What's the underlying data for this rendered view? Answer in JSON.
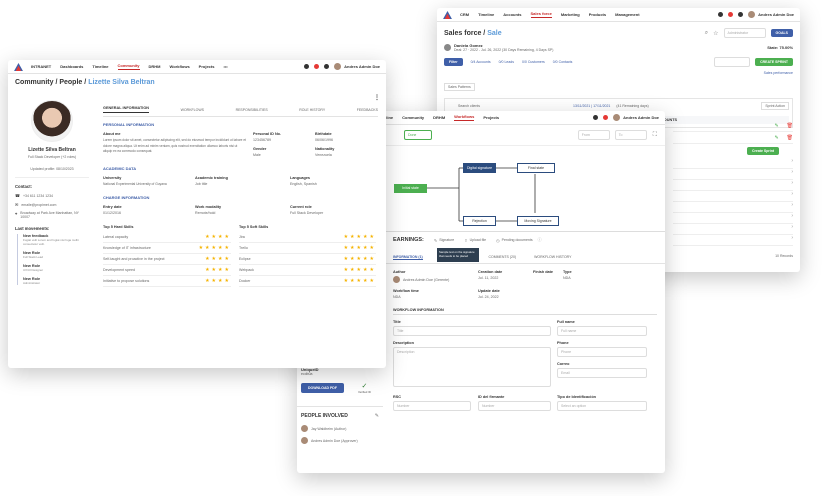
{
  "back_window": {
    "nav": [
      "CRM",
      "Timeline",
      "Accounts",
      "Sales force",
      "Marketing",
      "Products",
      "Management"
    ],
    "user": "Andres Admin Doe",
    "title_main": "Sales force / ",
    "title_accent": "Sale",
    "owner_name": "Daniela Gomez",
    "owner_meta": "Deal: 27 · 2022 - Jul. 26, 2022 (30 Days Remaining, 4 Days SP)",
    "state_label": "State: 75.00%",
    "filter_btn": "Filter",
    "tabs": [
      "0/4 Accounts",
      "0/0 Leads",
      "0/0 Customers",
      "0/0 Contacts"
    ],
    "create_btn": "CREATE SPRINT",
    "goals_btn": "GOALS",
    "admin_select": "Administrator",
    "sales_performance": "Sales performance",
    "sales_patterns": "Sales Patterns",
    "search_clients": "Search clients",
    "date_range": "13/11/2021 | 17/11/2021",
    "remaining": "(41 Remaining days)",
    "sprint_action": "Sprint Action",
    "col_title": "TITLE",
    "col_accounts": "ACCOUNTS",
    "create_sprint_small": "Create Sprint",
    "records": "10 Records"
  },
  "middle_window": {
    "nav": [
      "Timeline",
      "Community",
      "DRHM",
      "Workflows",
      "Projects"
    ],
    "user": "Andres Admin Doe",
    "done_select": "Done",
    "from_select": "From",
    "to_select": "To",
    "flow_initial": "Initial state",
    "flow_digital": "Digital signature",
    "flow_final": "Final state",
    "flow_rejection": "Rejection",
    "flow_moving": "Moving Signature",
    "tooltip": "Sample text on the signature that needs to be placed",
    "earnings_title": "EARNINGS:",
    "action_signature": "Signature",
    "action_upload": "Upload file",
    "action_pending": "Pending documents",
    "tabs": [
      "INFORMATION (1)",
      "DOCUMENTS (20)",
      "COMMENTS (20)",
      "WORKFLOW HISTORY"
    ],
    "author_label": "Author",
    "author_value": "Andres Admin Doe (Gerente)",
    "creation_label": "Creation date",
    "creation_value": "Jul. 11, 2022",
    "finish_label": "Finish date",
    "type_label": "Type",
    "type_value": "NDA",
    "wf_time_label": "Workflow time",
    "wf_time_value": "NDA",
    "update_label": "Update date",
    "update_value": "Jul. 24, 2022",
    "wf_info": "WORKFLOW INFORMATION",
    "title_label": "Title",
    "title_ph": "Title",
    "fullname_label": "Full name",
    "fullname_ph": "Full name",
    "description_label": "Description",
    "description_ph": "Description",
    "phone_label": "Phone",
    "phone_ph": "Phone",
    "email_label": "Correo",
    "email_ph": "Email",
    "rsc_label": "RSC",
    "rsc_ph": "Number",
    "id_label": "ID del firmante",
    "id_ph": "Number",
    "type_id_label": "Tipo de Identificación",
    "type_id_ph": "Select an option",
    "no_profiles": "No profiles found",
    "unique_label": "UniqueID",
    "unique_value": "ecdb0a",
    "download_btn": "DOWNLOAD PDF",
    "verified_label": "Verified ID",
    "people_title": "PEOPLE INVOLVED",
    "person1": "Jay Waldheim (Author)",
    "person2": "Andres Admin Doe (Approver)"
  },
  "front_window": {
    "nav": [
      "INTRANET",
      "Dashboards",
      "Timeline",
      "Community",
      "DRHM",
      "Workflows",
      "Projects"
    ],
    "user": "Andres Admin Doe",
    "title_main": "Community / People / ",
    "title_accent": "Lizette Silva Beltran",
    "profile_name": "Lizette Silva Beltran",
    "profile_role": "Full Stack Developer (+2 roles)",
    "updated": "Updated profile: 08/10/2023",
    "contact_title": "Contact:",
    "phone": "+34 611 1234 1234",
    "email": "emaile@propimet.com",
    "address": "Broadway at Park Ave Manhattan, NY 10007",
    "movements_title": "Last movements:",
    "movements": [
      {
        "title": "New feedback",
        "desc": "Fugiat velit Lorem and fugiat nisi fuga mollit consectetur velit."
      },
      {
        "title": "New Role",
        "desc": "Full Stack Lead"
      },
      {
        "title": "New Role",
        "desc": "UX/UI Designer"
      },
      {
        "title": "New Role",
        "desc": "Administrator"
      }
    ],
    "tabs": [
      "GENERAL INFORMATION",
      "WORKFLOWS",
      "RESPONSIBILITIES",
      "ROLE HISTORY",
      "FEEDBACKS"
    ],
    "personal_info": "PERSONAL INFORMATION",
    "about_label": "About me",
    "about_text": "Lorem ipsum dolor sit amet, consectetur adipiscing elit, sed do eiusmod tempor incididunt ut labore et dolore magna aliqua. Ut enim ad minim veniam, quis nostrud exercitation ullamco laboris nisi ut aliquip ex ea commodo consequat.",
    "personal_id_label": "Personal ID No.",
    "personal_id_value": "123456789",
    "birthdate_label": "Birthdate",
    "birthdate_value": "06/06/1996",
    "gender_label": "Gender",
    "gender_value": "Male",
    "nationality_label": "Nationality",
    "nationality_value": "Venezuela",
    "academic_title": "ACADEMIC DATA",
    "university_label": "University",
    "university_value": "National Experimental University of Guyana",
    "training_label": "Academic training",
    "training_value": "Job title",
    "languages_label": "Languages",
    "languages_value": "English, Spanish",
    "charge_title": "CHARGE INFORMATION",
    "entry_label": "Entry date",
    "entry_value": "01/12/2016",
    "modality_label": "Work modality",
    "modality_value": "Remote/hold",
    "role_label": "Current role",
    "role_value": "Full Stack Developer",
    "hard_title": "Top 5 Hard Skills",
    "soft_title": "Top 5 Soft Skills",
    "hard_skills": [
      "Lateral capacity",
      "Knowledge of IT infrastructure",
      "Self-taught and proactive in the project",
      "Development speed",
      "Initiative to propose solutions"
    ],
    "soft_skills": [
      "Jira",
      "Trello",
      "Eclipse",
      "Webpack",
      "Docker"
    ]
  }
}
